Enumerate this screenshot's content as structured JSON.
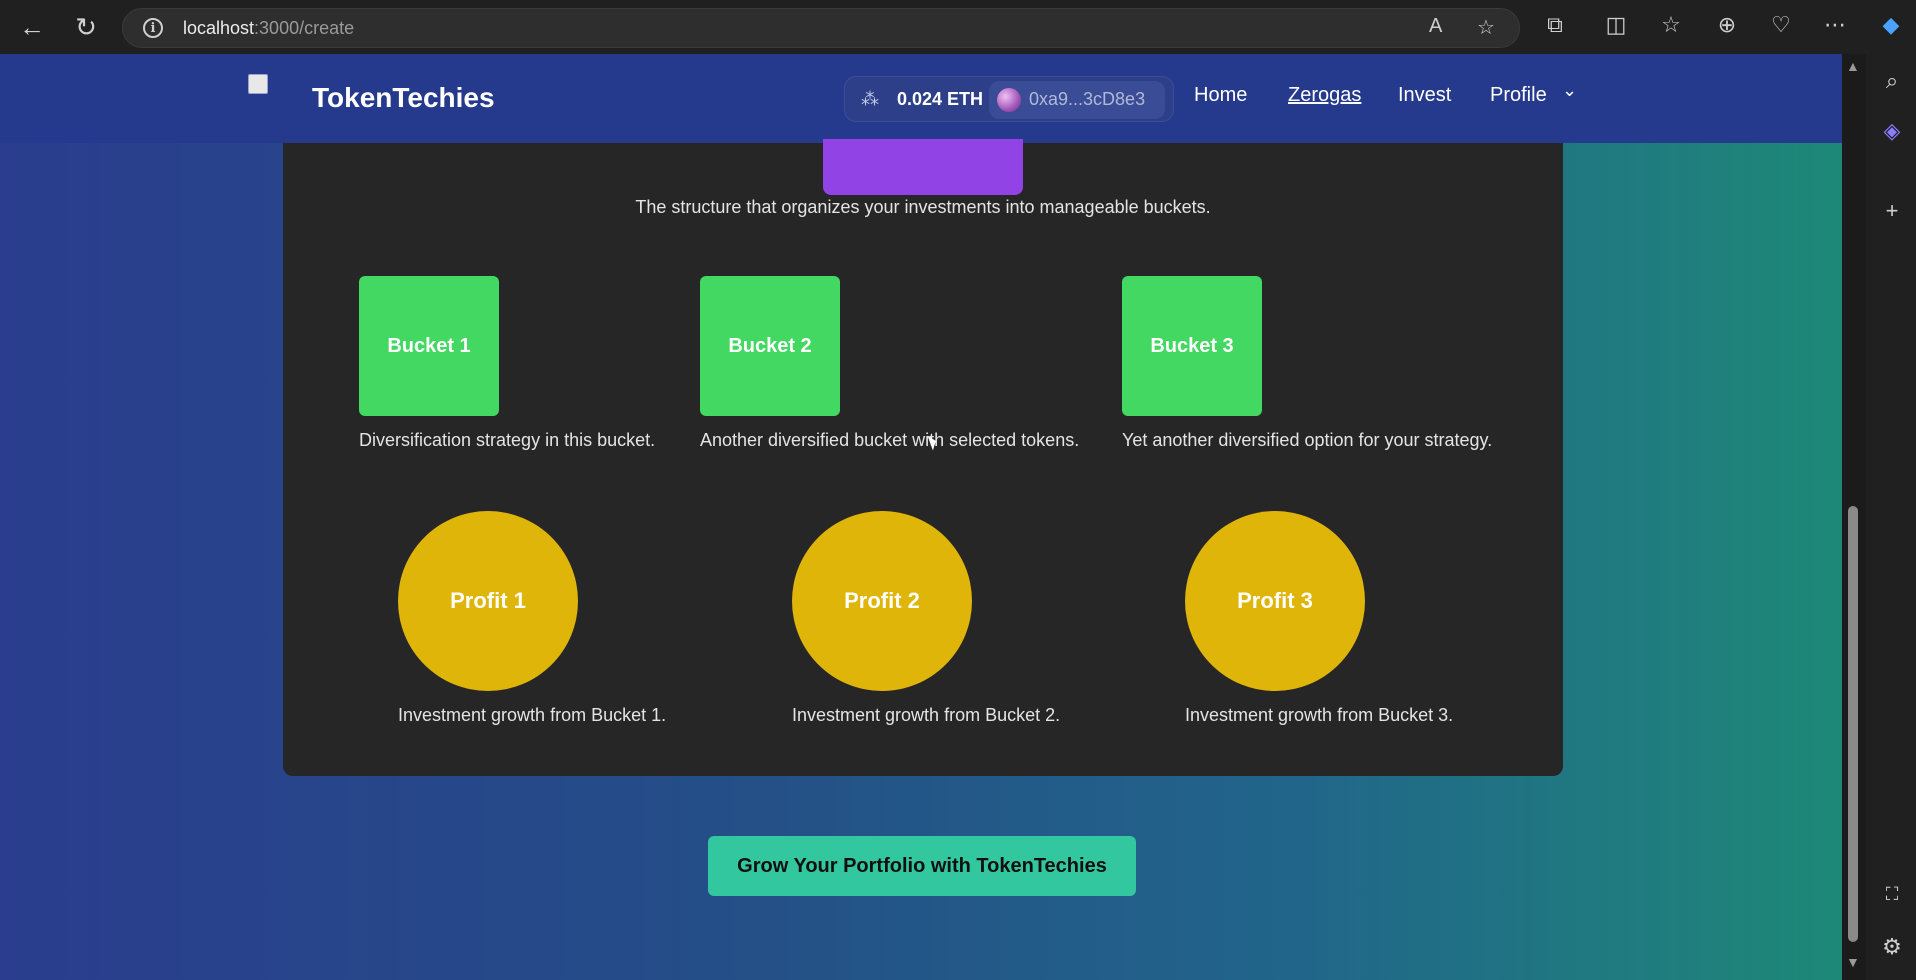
{
  "browser": {
    "url_host": "localhost",
    "url_path": ":3000/create"
  },
  "header": {
    "brand": "TokenTechies",
    "wallet": {
      "balance": "0.024 ETH",
      "address": "0xa9...3cD8e3"
    },
    "nav": {
      "home": "Home",
      "zerogas": "Zerogas",
      "invest": "Invest",
      "profile": "Profile"
    }
  },
  "section": {
    "subtitle": "The structure that organizes your investments into manageable buckets."
  },
  "buckets": [
    {
      "label": "Bucket 1",
      "description": "Diversification strategy in this bucket."
    },
    {
      "label": "Bucket 2",
      "description": "Another diversified bucket with selected tokens."
    },
    {
      "label": "Bucket 3",
      "description": "Yet another diversified option for your strategy."
    }
  ],
  "profits": [
    {
      "label": "Profit 1",
      "description": "Investment growth from Bucket 1."
    },
    {
      "label": "Profit 2",
      "description": "Investment growth from Bucket 2."
    },
    {
      "label": "Profit 3",
      "description": "Investment growth from Bucket 3."
    }
  ],
  "cta": {
    "label": "Grow Your Portfolio with TokenTechies"
  },
  "colors": {
    "bucket": "#42d861",
    "profit": "#e0b50a",
    "cta": "#33c7a0",
    "purple": "#9143e6",
    "header": "#253a8c"
  }
}
